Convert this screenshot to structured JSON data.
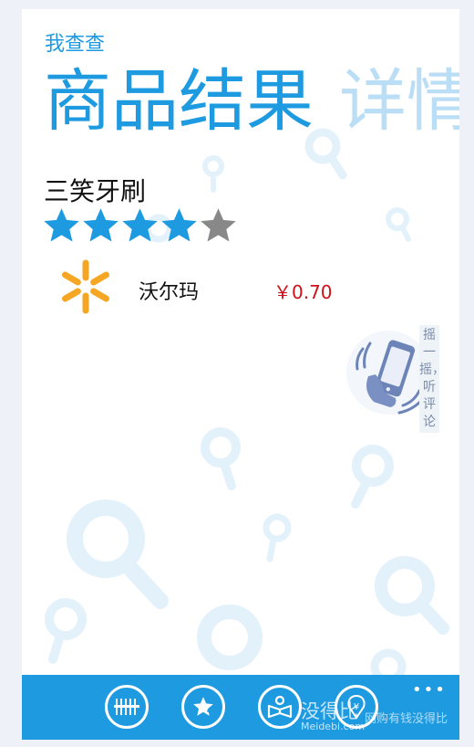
{
  "app": {
    "title": "我查查"
  },
  "pivot": {
    "active": "商品结果",
    "next": "详情"
  },
  "product": {
    "name": "三笑牙刷",
    "rating": 4,
    "rating_max": 5
  },
  "store": {
    "name": "沃尔玛",
    "price": "￥0.70",
    "logo_color": "#f5a623"
  },
  "shake": {
    "label": "摇一摇，听评论"
  },
  "appbar": {
    "buttons": [
      {
        "icon": "barcode-icon"
      },
      {
        "icon": "star-plus-icon"
      },
      {
        "icon": "book-reader-icon"
      },
      {
        "icon": "yen-tag-icon"
      }
    ],
    "more": "•••"
  },
  "watermark": {
    "brand": "没得比",
    "domain": "Meidebi.com",
    "slogan": "网购有钱没得比"
  },
  "colors": {
    "accent": "#1e9ae0",
    "price": "#d0101a",
    "star_on": "#1e9ae0",
    "star_off": "#888888"
  }
}
